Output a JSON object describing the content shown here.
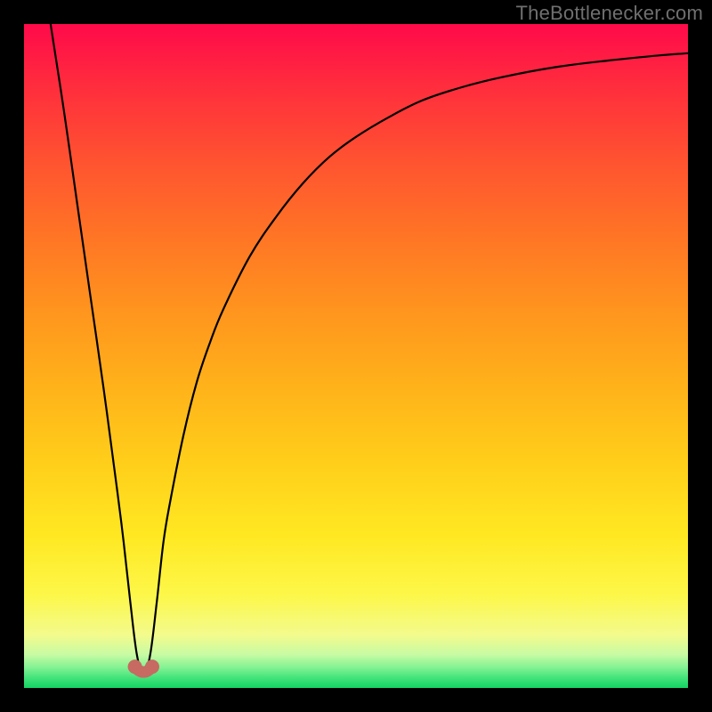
{
  "attribution": "TheBottlenecker.com",
  "chart_data": {
    "type": "line",
    "title": "",
    "xlabel": "",
    "ylabel": "",
    "xlim": [
      0,
      100
    ],
    "ylim": [
      0,
      100
    ],
    "optimum_x": 18,
    "series": [
      {
        "name": "bottleneck-curve",
        "x": [
          4,
          6,
          8,
          10,
          12,
          14,
          15,
          16,
          17,
          18,
          19,
          20,
          21,
          22,
          24,
          26,
          28,
          30,
          34,
          38,
          42,
          46,
          50,
          55,
          60,
          66,
          72,
          80,
          88,
          96,
          100
        ],
        "y": [
          100,
          87,
          73,
          59,
          45,
          30,
          22,
          13,
          5,
          2,
          5,
          13,
          22,
          28,
          38,
          46,
          52,
          57,
          65,
          71,
          76,
          80,
          83,
          86,
          88.5,
          90.5,
          92,
          93.5,
          94.5,
          95.3,
          95.6
        ]
      }
    ],
    "markers": [
      {
        "x": 16.7,
        "y": 3.2
      },
      {
        "x": 19.3,
        "y": 3.2
      }
    ],
    "marker_connector": {
      "x1": 16.7,
      "y1": 3.2,
      "x2": 19.3,
      "y2": 3.2,
      "dip_y": 1.6
    },
    "gradient_stops": [
      {
        "pct": 0,
        "color": "#ff0a4a"
      },
      {
        "pct": 50,
        "color": "#ffb31a"
      },
      {
        "pct": 85,
        "color": "#fdf749"
      },
      {
        "pct": 100,
        "color": "#14d463"
      }
    ]
  }
}
